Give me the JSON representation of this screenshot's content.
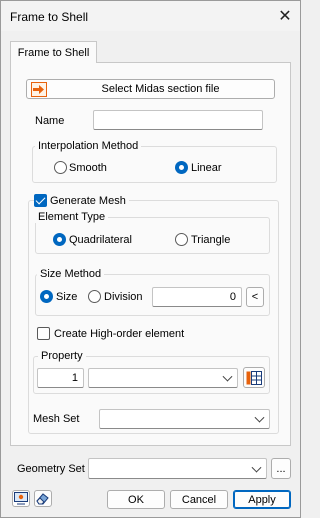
{
  "window": {
    "title": "Frame to Shell",
    "close_glyph": "✕"
  },
  "tab": {
    "label": "Frame to Shell"
  },
  "select_section_button": {
    "label": "Select Midas section file",
    "icon": "import-arrow-icon"
  },
  "name": {
    "label": "Name",
    "value": ""
  },
  "interpolation": {
    "title": "Interpolation Method",
    "options": [
      "Smooth",
      "Linear"
    ],
    "selected": "Linear"
  },
  "generate_mesh": {
    "label": "Generate Mesh",
    "checked": true
  },
  "element_type": {
    "title": "Element Type",
    "options": [
      "Quadrilateral",
      "Triangle"
    ],
    "selected": "Quadrilateral"
  },
  "size_method": {
    "title": "Size Method",
    "options": [
      "Size",
      "Division"
    ],
    "selected": "Size",
    "value": "0",
    "pick_button": "<"
  },
  "high_order": {
    "label": "Create High-order element",
    "checked": false
  },
  "property": {
    "title": "Property",
    "number": "1",
    "selected": "",
    "icon": "property-table-icon"
  },
  "mesh_set": {
    "label": "Mesh Set",
    "selected": ""
  },
  "geometry_set": {
    "label": "Geometry Set",
    "selected": "",
    "more_button": "..."
  },
  "footer": {
    "ok": "OK",
    "cancel": "Cancel",
    "apply": "Apply",
    "icons": [
      "preview-icon",
      "eraser-icon"
    ]
  },
  "colors": {
    "accent": "#0067c0",
    "icon_orange": "#e8620c"
  }
}
